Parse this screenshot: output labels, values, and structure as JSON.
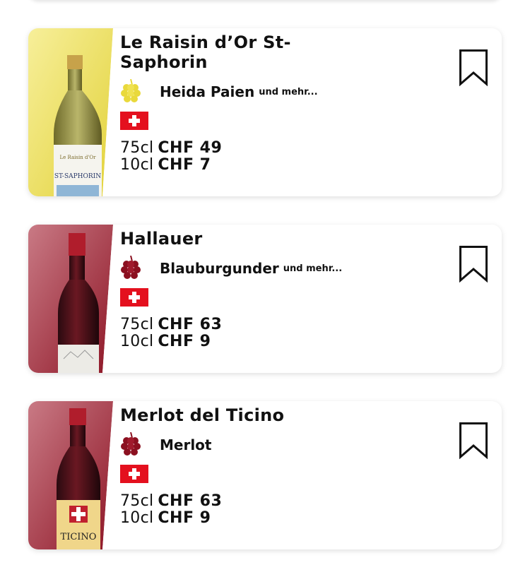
{
  "wines": [
    {
      "name": "Le Raisin d’Or St-Saphorin",
      "grape": "Heida Paien",
      "more": "und mehr...",
      "wine_color": "white",
      "country_flag": "switzerland-flag",
      "prices": [
        {
          "volume": "75cl",
          "price": "CHF 49"
        },
        {
          "volume": "10cl",
          "price": "CHF 7"
        }
      ]
    },
    {
      "name": "Hallauer",
      "grape": "Blauburgunder",
      "more": "und mehr...",
      "wine_color": "red",
      "country_flag": "switzerland-flag",
      "prices": [
        {
          "volume": "75cl",
          "price": "CHF 63"
        },
        {
          "volume": "10cl",
          "price": "CHF 9"
        }
      ]
    },
    {
      "name": "Merlot del Ticino",
      "grape": "Merlot",
      "more": "",
      "wine_color": "red",
      "country_flag": "switzerland-flag",
      "prices": [
        {
          "volume": "75cl",
          "price": "CHF 63"
        },
        {
          "volume": "10cl",
          "price": "CHF 9"
        }
      ]
    }
  ],
  "bottle_labels": {
    "label_1": "ST-SAPHORIN",
    "label_3": "TICINO"
  },
  "colors": {
    "white_wine_grape": "#e9d93c",
    "red_wine_grape": "#8b1020",
    "swiss_red": "#e4101e"
  }
}
